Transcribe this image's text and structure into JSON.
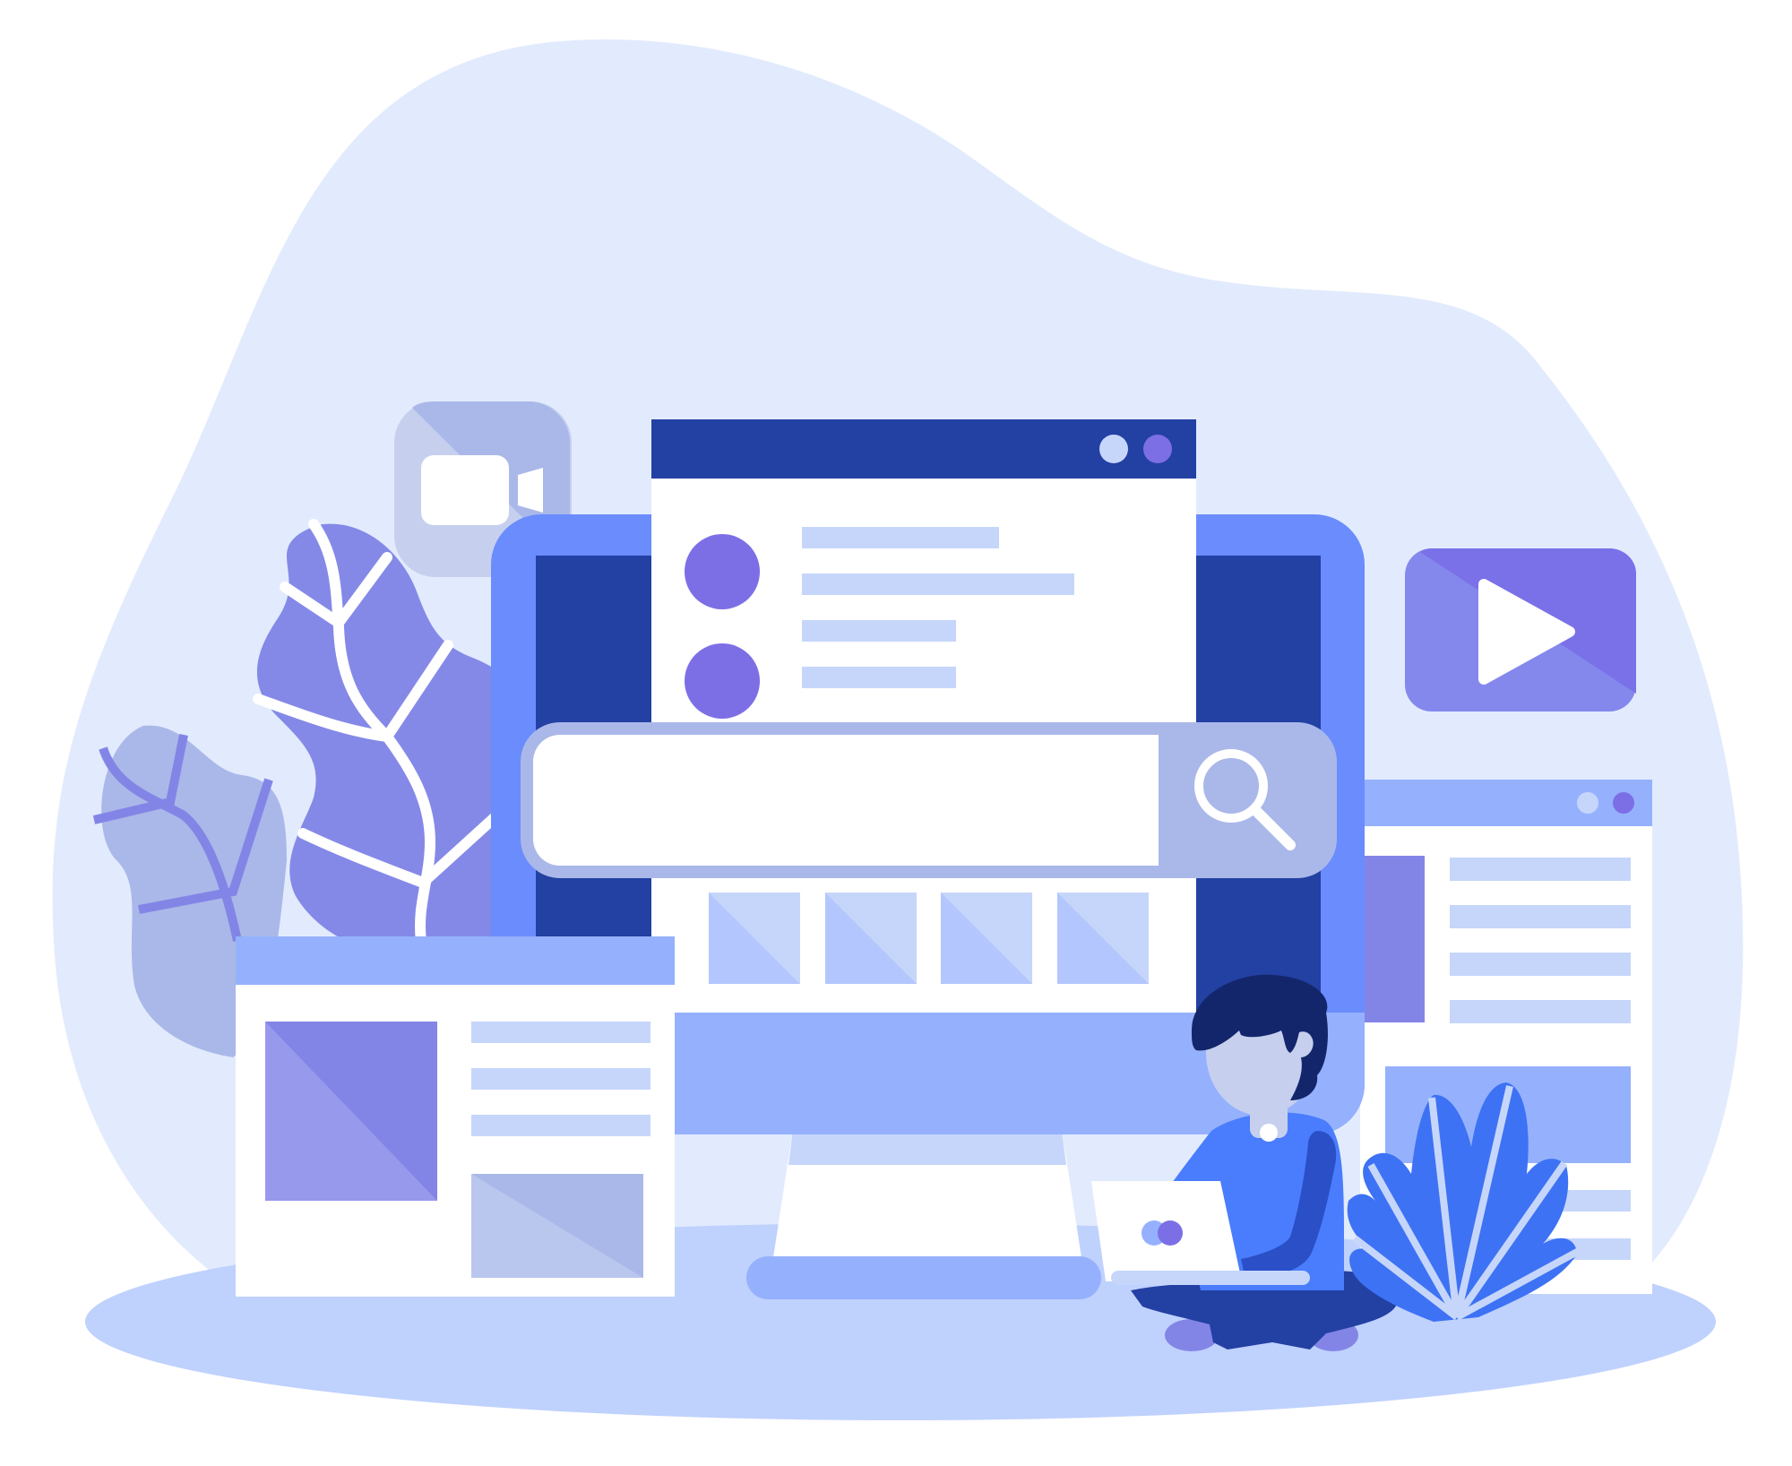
{
  "scene": {
    "background_blob_color": "#e2ebfd",
    "ground_color": "#bfd1fd"
  },
  "colors": {
    "navy": "#2340a3",
    "blue": "#6a8cfd",
    "light_blue": "#95b1fd",
    "pale_blue": "#c6d6fb",
    "purple": "#7c6fe6",
    "lavender": "#aab8e9",
    "white": "#ffffff",
    "hair": "#14266b"
  },
  "icons": {
    "video_camera": "video-camera-icon",
    "play": "play-icon",
    "search": "search-icon",
    "window_dots": "window-dots-icon"
  },
  "search_bar": {
    "value": ""
  }
}
